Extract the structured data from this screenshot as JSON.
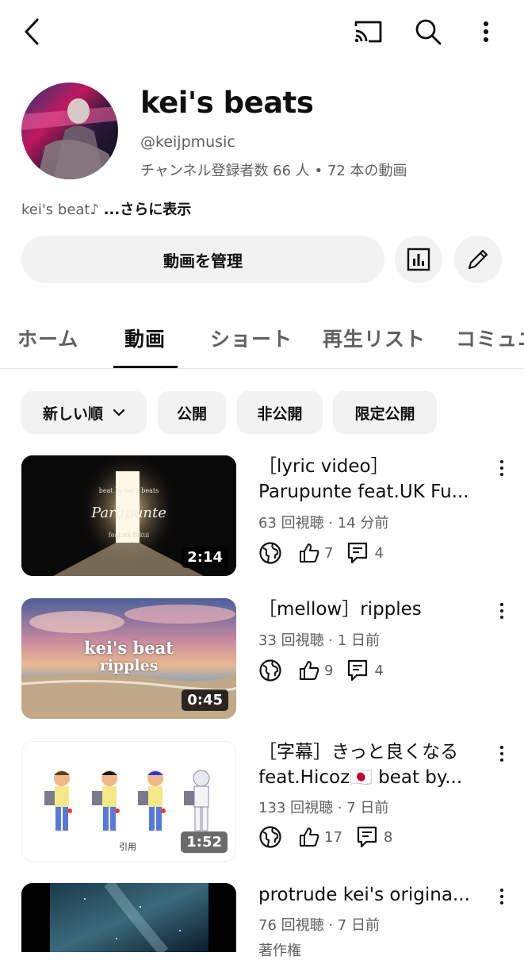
{
  "channel": {
    "name": "kei's beats",
    "handle": "@keijpmusic",
    "stats": "チャンネル登録者数 66 人 • 72 本の動画",
    "description": "kei's beat♪",
    "more_label": "...さらに表示"
  },
  "actions": {
    "manage_label": "動画を管理",
    "analytics_icon": "analytics-icon",
    "edit_icon": "pencil-icon"
  },
  "tabs": [
    {
      "label": "ホーム"
    },
    {
      "label": "動画",
      "active": true
    },
    {
      "label": "ショート"
    },
    {
      "label": "再生リスト"
    },
    {
      "label": "コミュニ"
    }
  ],
  "filters": [
    {
      "label": "新しい順",
      "selected": true
    },
    {
      "label": "公開"
    },
    {
      "label": "非公開"
    },
    {
      "label": "限定公開"
    }
  ],
  "videos": [
    {
      "title_lines": [
        "［lyric video］",
        "Parupunte feat.UK Fu..."
      ],
      "meta": "63 回視聴 · 14 分前",
      "likes": "7",
      "comments": "4",
      "duration": "2:14",
      "thumb_text": {
        "top": "beat by kei's beats",
        "main": "Parupunte",
        "sub": "feat.uk fukui"
      }
    },
    {
      "title_lines": [
        "［mellow］ripples"
      ],
      "meta": "33 回視聴 · 1 日前",
      "likes": "9",
      "comments": "4",
      "duration": "0:45",
      "thumb_text": {
        "main": "kei's beat",
        "sub": "ripples"
      }
    },
    {
      "title_lines": [
        "［字幕］きっと良くなる",
        "feat.Hicoz🇯🇵 beat by..."
      ],
      "meta": "133 回視聴 · 7 日前",
      "likes": "17",
      "comments": "8",
      "duration": "1:52",
      "thumb_text": {
        "caption": "引用"
      }
    },
    {
      "title_lines": [
        "protrude kei's origina..."
      ],
      "meta": "76 回視聴 · 7 日前",
      "extra": "著作権"
    }
  ],
  "colors": {
    "text": "#0f0f0f",
    "secondary": "#606060",
    "chip_bg": "#f2f2f2"
  }
}
